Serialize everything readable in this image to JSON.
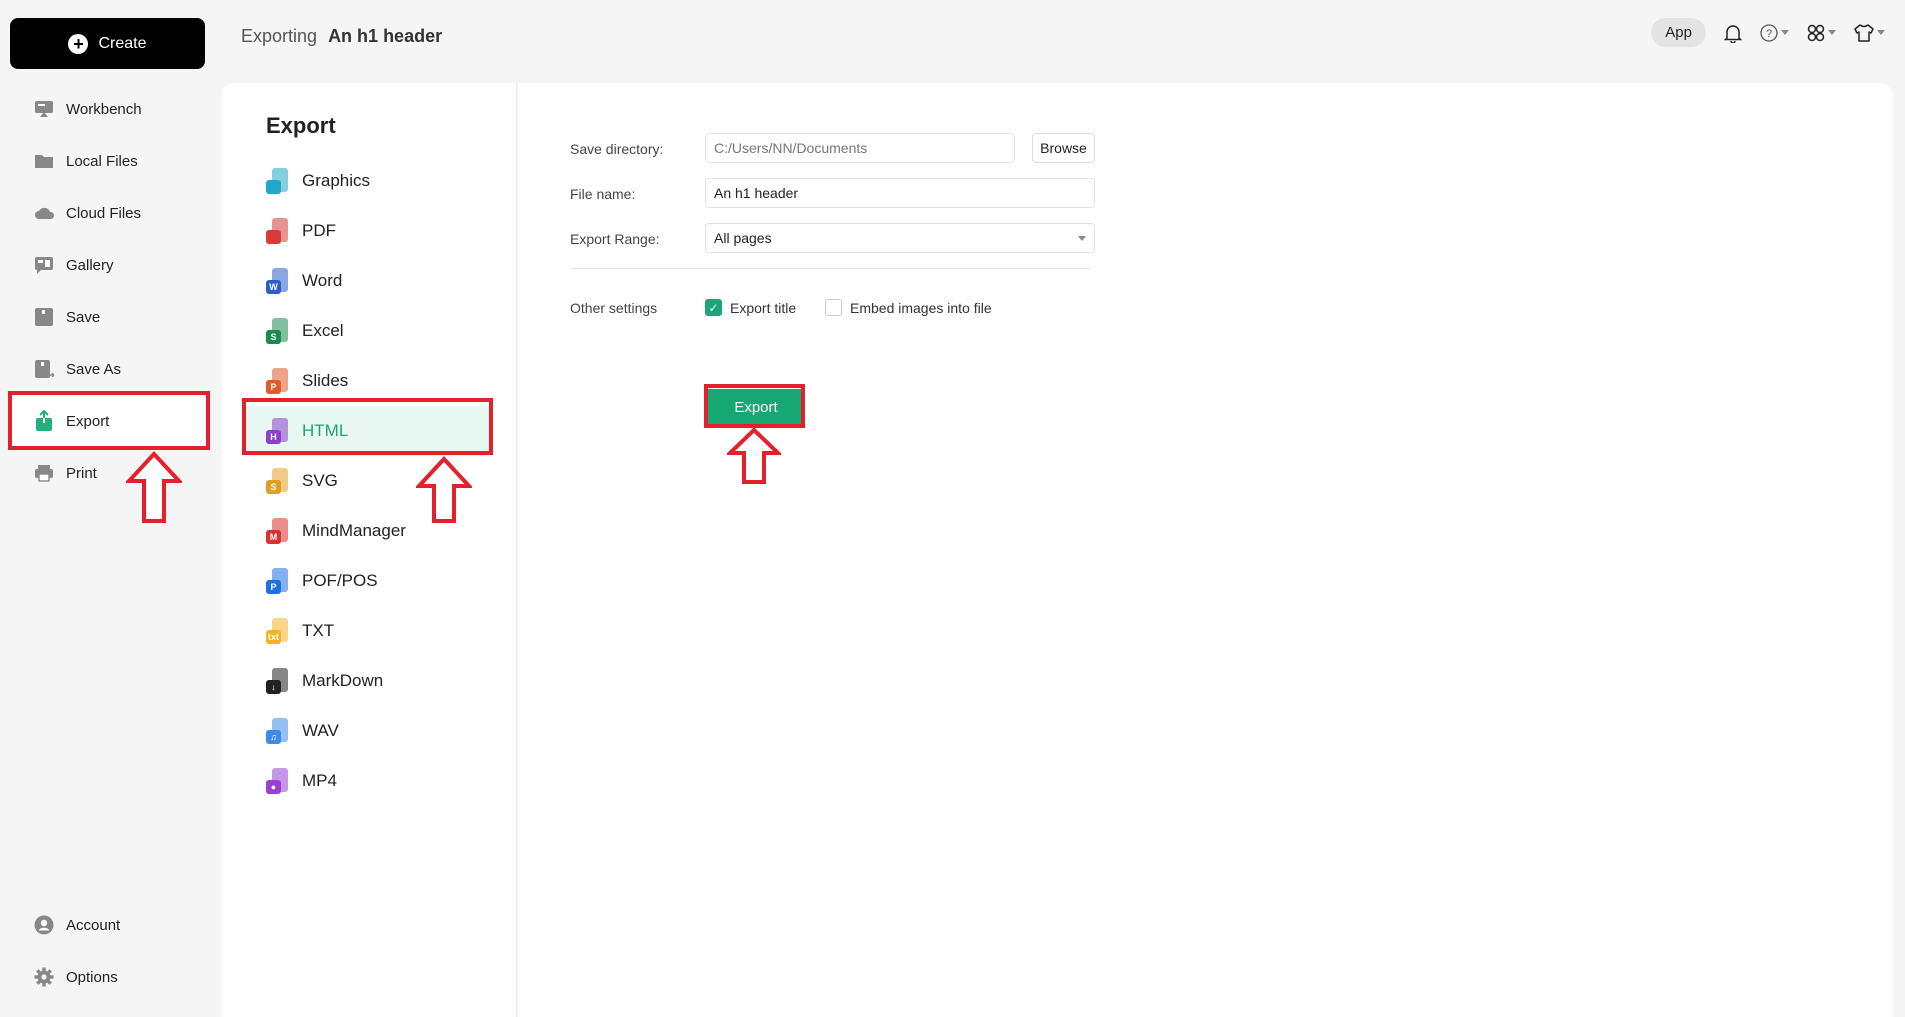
{
  "header": {
    "title_prefix": "Exporting",
    "title_doc": "An h1 header",
    "app_label": "App",
    "icons": [
      "bell-icon",
      "help-icon",
      "apps-grid-icon",
      "theme-shirt-icon"
    ]
  },
  "sidebar": {
    "create_label": "Create",
    "items": [
      {
        "label": "Workbench",
        "icon": "workbench-icon"
      },
      {
        "label": "Local Files",
        "icon": "folder-icon"
      },
      {
        "label": "Cloud Files",
        "icon": "cloud-icon"
      },
      {
        "label": "Gallery",
        "icon": "gallery-icon"
      },
      {
        "label": "Save",
        "icon": "save-icon"
      },
      {
        "label": "Save As",
        "icon": "save-as-icon"
      },
      {
        "label": "Export",
        "icon": "export-icon",
        "active": true
      },
      {
        "label": "Print",
        "icon": "print-icon"
      }
    ],
    "bottom_items": [
      {
        "label": "Account",
        "icon": "account-icon"
      },
      {
        "label": "Options",
        "icon": "gear-icon"
      }
    ]
  },
  "export_panel": {
    "heading": "Export",
    "formats": [
      {
        "label": "Graphics",
        "badge": "",
        "color": "#22a7c9"
      },
      {
        "label": "PDF",
        "badge": "",
        "color": "#d93a3a"
      },
      {
        "label": "Word",
        "badge": "W",
        "color": "#2b5fc8"
      },
      {
        "label": "Excel",
        "badge": "S",
        "color": "#1b8a4e"
      },
      {
        "label": "Slides",
        "badge": "P",
        "color": "#e05a2b"
      },
      {
        "label": "HTML",
        "badge": "H",
        "color": "#8a3fd1",
        "active": true
      },
      {
        "label": "SVG",
        "badge": "S",
        "color": "#e0a024"
      },
      {
        "label": "MindManager",
        "badge": "M",
        "color": "#d9322e"
      },
      {
        "label": "POF/POS",
        "badge": "P",
        "color": "#1e6fe0"
      },
      {
        "label": "TXT",
        "badge": "txt",
        "color": "#f2b424"
      },
      {
        "label": "MarkDown",
        "badge": "↓",
        "color": "#222222"
      },
      {
        "label": "WAV",
        "badge": "♫",
        "color": "#3f8ae8"
      },
      {
        "label": "MP4",
        "badge": "●",
        "color": "#9b3fd1"
      }
    ]
  },
  "settings": {
    "save_directory_label": "Save directory:",
    "save_directory_value": "C:/Users/NN/Documents",
    "browse_label": "Browse",
    "file_name_label": "File name:",
    "file_name_value": "An h1 header",
    "export_range_label": "Export Range:",
    "export_range_value": "All pages",
    "other_settings_label": "Other settings",
    "export_title_label": "Export title",
    "export_title_checked": true,
    "embed_images_label": "Embed images into file",
    "embed_images_checked": false,
    "export_button_label": "Export"
  },
  "colors": {
    "accent": "#15a873",
    "annotation": "#e3202b",
    "active_bg": "#e8f7f1"
  }
}
